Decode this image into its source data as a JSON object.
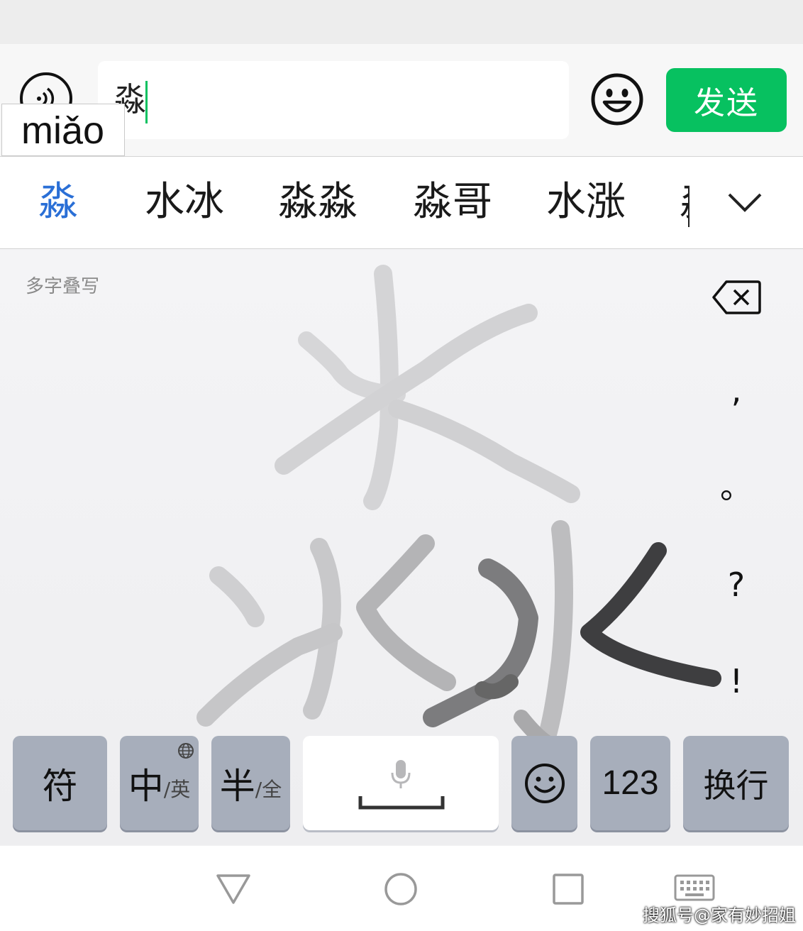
{
  "input_bar": {
    "typed_text": "淼",
    "pinyin": "miǎo",
    "send_label": "发送"
  },
  "candidates": [
    {
      "text": "淼",
      "selected": true
    },
    {
      "text": "水冰",
      "selected": false
    },
    {
      "text": "淼淼",
      "selected": false
    },
    {
      "text": "淼哥",
      "selected": false
    },
    {
      "text": "水涨",
      "selected": false
    },
    {
      "text": "淼",
      "selected": false
    }
  ],
  "handwriting": {
    "mode_label": "多字叠写"
  },
  "punctuation": [
    ",",
    "。",
    "?",
    "!"
  ],
  "keys": {
    "symbol": "符",
    "lang_main": "中",
    "lang_alt": "/英",
    "width_main": "半",
    "width_alt": "/全",
    "numbers": "123",
    "enter": "换行"
  },
  "watermark": "搜狐号@家有妙招姐",
  "colors": {
    "accent_green": "#07c160",
    "selected_candidate": "#2a6fd6",
    "key_gray": "#a7aebb"
  },
  "icons": {
    "voice": "voice-wave-icon",
    "emoji": "smiley-icon",
    "expand": "chevron-down-icon",
    "backspace": "backspace-icon",
    "globe": "globe-icon",
    "mic": "microphone-icon",
    "nav_back": "triangle-back-icon",
    "nav_home": "circle-home-icon",
    "nav_recent": "square-recent-icon",
    "nav_keyboard": "keyboard-icon"
  }
}
